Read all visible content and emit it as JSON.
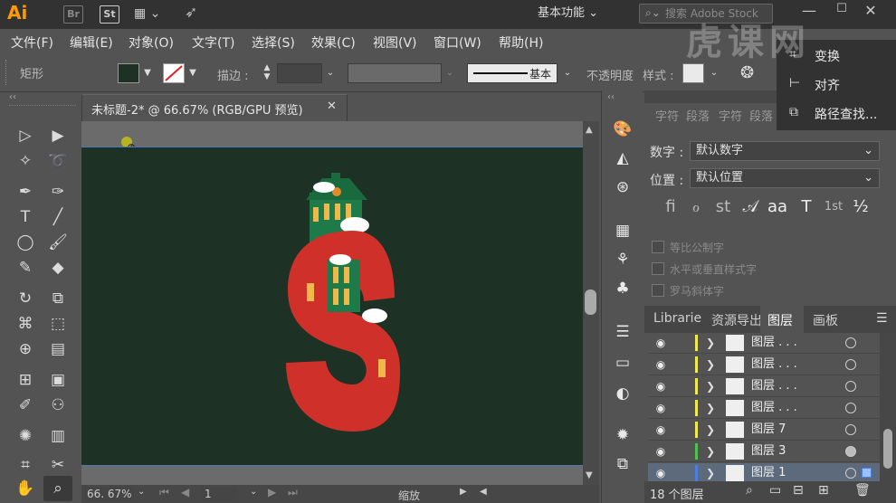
{
  "titlebar": {
    "logo": "Ai",
    "bridge": "Br",
    "stock": "St",
    "workspace": "基本功能",
    "search_placeholder": "搜索 Adobe Stock"
  },
  "menu": [
    "文件(F)",
    "编辑(E)",
    "对象(O)",
    "文字(T)",
    "选择(S)",
    "效果(C)",
    "视图(V)",
    "窗口(W)",
    "帮助(H)"
  ],
  "controlbar": {
    "shape_label": "矩形",
    "stroke_label": "描边 :",
    "brush_label": "基本",
    "opacity_label": "不透明度",
    "style_label": "样式 :",
    "fill_color": "#1e3125"
  },
  "document": {
    "tab_title": "未标题-2* @ 66.67% (RGB/GPU 预览)",
    "zoom": "66. 67%",
    "page": "1",
    "status": "缩放"
  },
  "floating_panel": {
    "items": [
      "变换",
      "对齐",
      "路径查找..."
    ]
  },
  "char_panel": {
    "tabs": [
      "字符",
      "段落",
      "字符",
      "段落"
    ],
    "number_label": "数字 :",
    "number_value": "默认数字",
    "position_label": "位置 :",
    "position_value": "默认位置",
    "checkboxes": [
      "等比公制字",
      "水平或垂直样式字",
      "罗马斜体字"
    ]
  },
  "layers_panel": {
    "tabs": [
      "Librarie",
      "资源导出",
      "图层",
      "画板"
    ],
    "layers": [
      {
        "name": "图层 . . .",
        "color": "#f2e94e"
      },
      {
        "name": "图层 . . .",
        "color": "#f2e94e"
      },
      {
        "name": "图层 . . .",
        "color": "#f2e94e"
      },
      {
        "name": "图层 . . .",
        "color": "#f2e94e"
      },
      {
        "name": "图层 7",
        "color": "#f2e94e"
      },
      {
        "name": "图层 3",
        "color": "#4fc24f"
      },
      {
        "name": "图层 1",
        "color": "#4a7fe0"
      }
    ],
    "count": "18 个图层"
  },
  "watermark": "虎课网",
  "colors": {
    "artboard": "#1e3125",
    "s_letter": "#d0302a",
    "house": "#1f7a4a"
  }
}
